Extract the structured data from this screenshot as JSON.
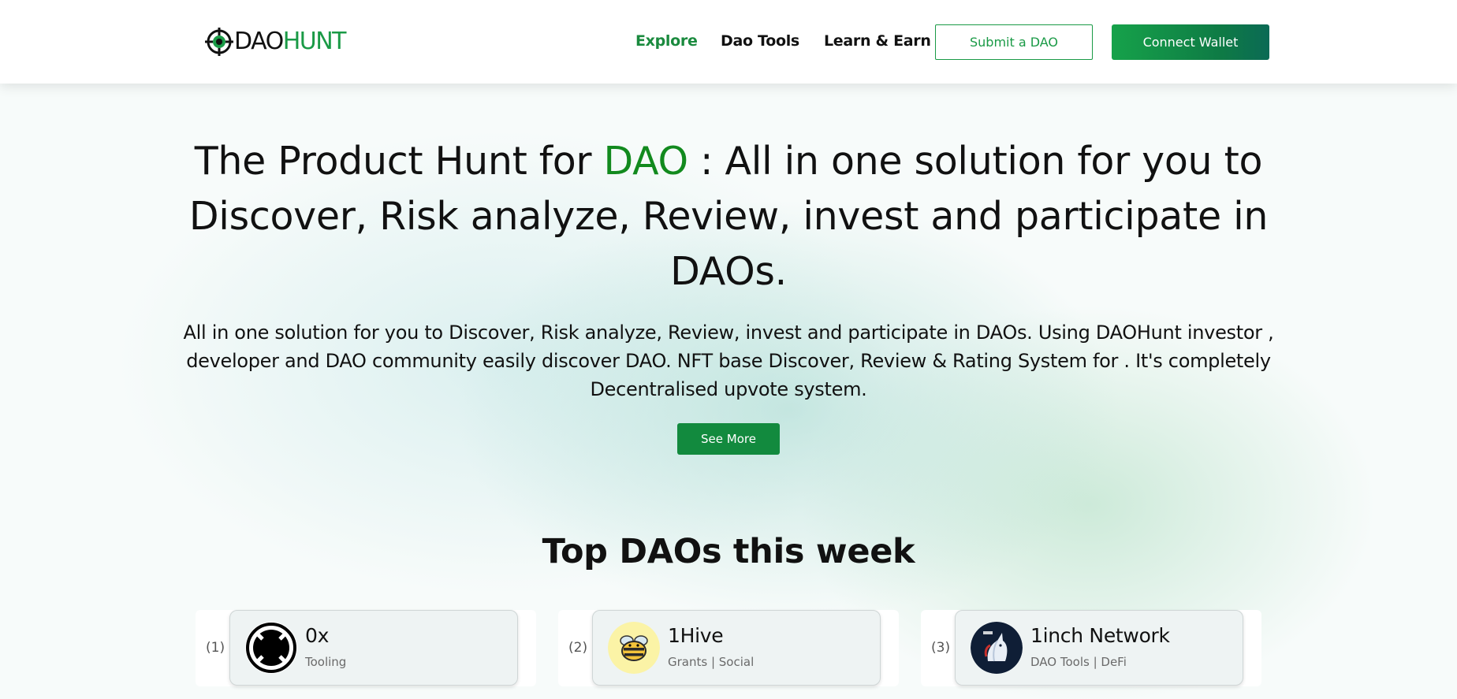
{
  "brand": {
    "logo_dao": "DAO",
    "logo_hunt": "HUNT",
    "accent_color": "#1a9a46"
  },
  "nav": {
    "links": [
      {
        "label": "Explore",
        "active": true
      },
      {
        "label": "Dao Tools",
        "active": false
      },
      {
        "label": "Learn & Earn",
        "active": false
      }
    ],
    "submit_label": "Submit a DAO",
    "connect_label": "Connect Wallet"
  },
  "hero": {
    "title_part1": "The Product Hunt for ",
    "title_accent": "DAO",
    "title_part2": " : All in one solution for you to Discover, Risk analyze, Review, invest and participate in DAOs.",
    "description": "All in one solution for you to Discover, Risk analyze, Review, invest and participate in DAOs. Using DAOHunt investor , developer and DAO community easily discover DAO. NFT base Discover, Review & Rating System for . It's completely Decentralised upvote system.",
    "button_label": "See More"
  },
  "top_daos": {
    "title": "Top DAOs this week",
    "items": [
      {
        "rank": "(1)",
        "name": "0x",
        "tags": "Tooling",
        "icon": "0x-logo-icon"
      },
      {
        "rank": "(2)",
        "name": "1Hive",
        "tags": "Grants | Social",
        "icon": "bee-icon"
      },
      {
        "rank": "(3)",
        "name": "1inch Network",
        "tags": "DAO Tools | DeFi",
        "icon": "unicorn-icon"
      }
    ]
  }
}
